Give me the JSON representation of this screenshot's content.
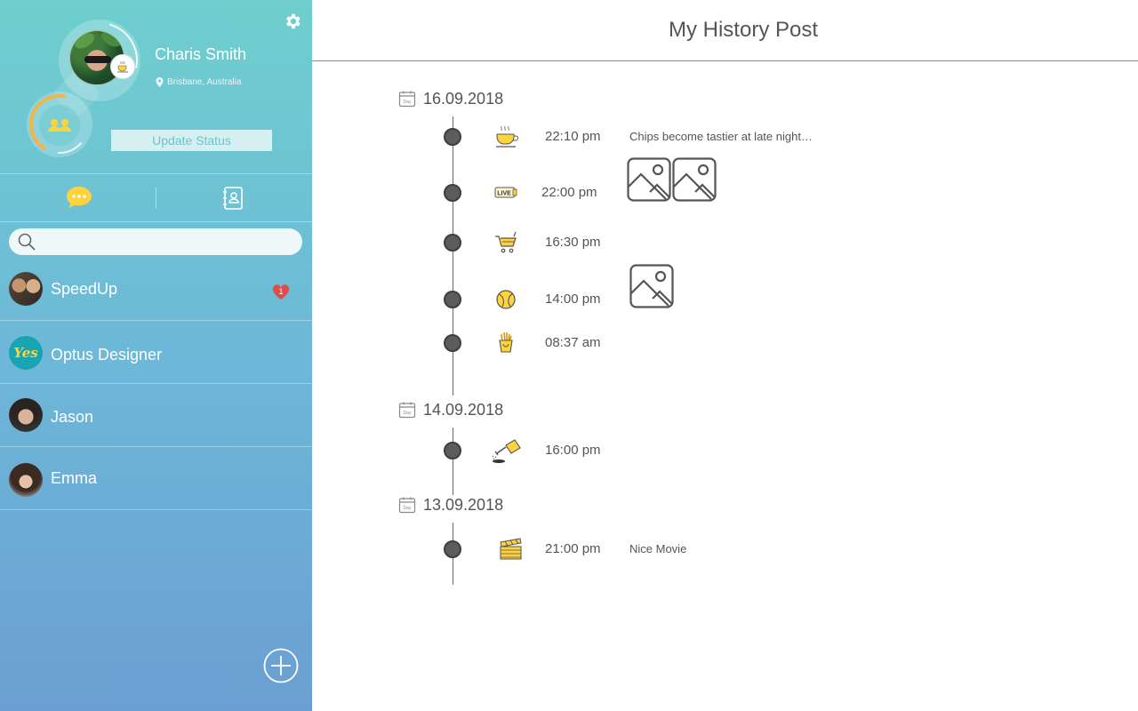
{
  "sidebar": {
    "profile": {
      "name": "Charis Smith",
      "location": "Brisbane, Australia",
      "update_status_label": "Update Status"
    },
    "tabs": [
      {
        "icon": "chat-bubble-icon",
        "active": true
      },
      {
        "icon": "contacts-book-icon",
        "active": false
      }
    ],
    "search": {
      "placeholder": "",
      "value": ""
    },
    "chats": [
      {
        "name": "SpeedUp",
        "unread": "1"
      },
      {
        "name": "Optus Designer",
        "avatar_text": "Yes"
      },
      {
        "name": "Jason"
      },
      {
        "name": "Emma"
      }
    ],
    "colors": {
      "gradient_top": "#6ecfce",
      "gradient_bottom": "#6b9fd3",
      "badge": "#e04b4b",
      "accent": "#ffd33d"
    }
  },
  "main": {
    "title": "My History Post",
    "groups": [
      {
        "date": "16.09.2018",
        "entries": [
          {
            "time": "22:10 pm",
            "icon": "coffee-cup-icon",
            "note": "Chips become tastier at late night…"
          },
          {
            "time": "22:00 pm",
            "icon": "live-badge-icon",
            "icon_text": "LIVE",
            "images": 2
          },
          {
            "time": "16:30 pm",
            "icon": "shopping-cart-icon"
          },
          {
            "time": "14:00 pm",
            "icon": "tennis-ball-icon",
            "images": 1
          },
          {
            "time": "08:37 am",
            "icon": "fries-icon"
          }
        ]
      },
      {
        "date": "14.09.2018",
        "entries": [
          {
            "time": "16:00 pm",
            "icon": "watering-can-icon"
          }
        ]
      },
      {
        "date": "13.09.2018",
        "entries": [
          {
            "time": "21:00 pm",
            "icon": "clapperboard-icon",
            "note": "Nice Movie"
          }
        ]
      }
    ]
  }
}
